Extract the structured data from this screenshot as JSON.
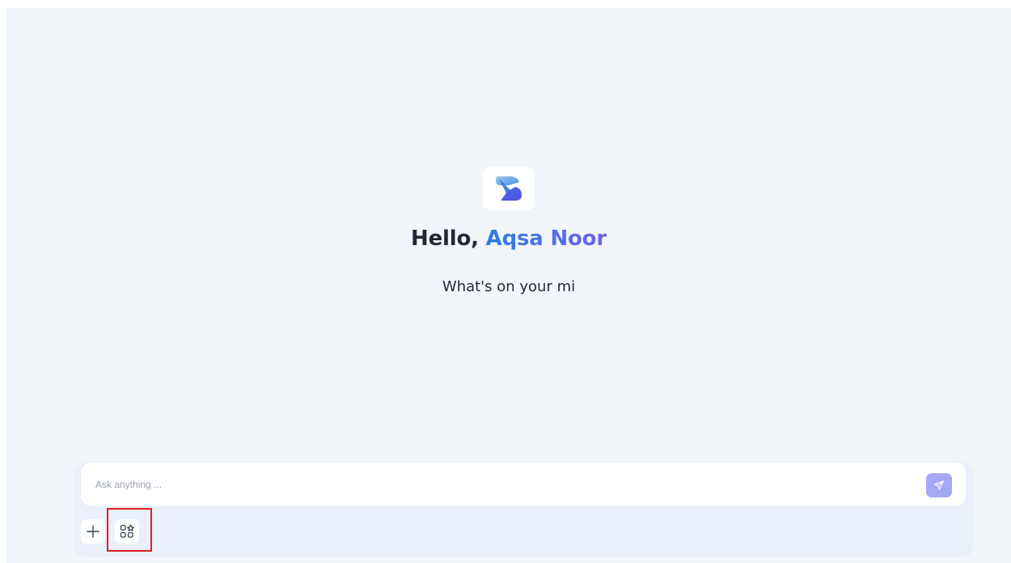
{
  "hero": {
    "greeting_prefix": "Hello,",
    "user_name": "Aqsa Noor",
    "subtitle": "What's on your mi"
  },
  "composer": {
    "placeholder": "Ask anything ...",
    "value": ""
  },
  "icons": {
    "logo": "app-logo-icon",
    "send": "send-icon",
    "plus": "plus-icon",
    "apps": "apps-grid-icon"
  },
  "colors": {
    "background": "#f2f5fa",
    "accent_start": "#2f7de1",
    "accent_end": "#6d63e8",
    "send_button": "#a5a8f5",
    "highlight": "#e11d1d"
  }
}
